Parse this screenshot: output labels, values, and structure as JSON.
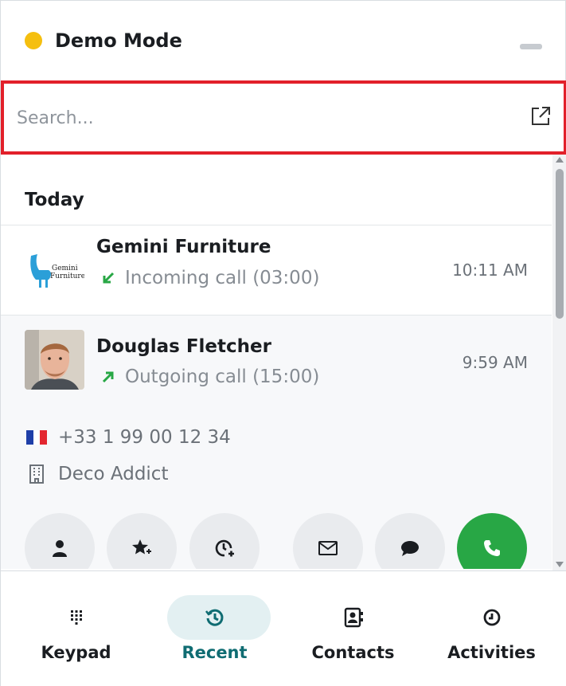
{
  "header": {
    "title": "Demo Mode",
    "status_color": "#f5bf0f"
  },
  "search": {
    "placeholder": "Search..."
  },
  "list": {
    "section": "Today",
    "calls": [
      {
        "name": "Gemini Furniture",
        "type": "Incoming call (03:00)",
        "direction": "incoming",
        "time": "10:11 AM",
        "logo_text": "Gemini Furniture"
      },
      {
        "name": "Douglas Fletcher",
        "type": "Outgoing call (15:00)",
        "direction": "outgoing",
        "time": "9:59 AM",
        "phone": "+33 1 99 00 12 34",
        "company": "Deco Addict",
        "actions": [
          "contact-icon",
          "add-favorite-icon",
          "schedule-activity-icon",
          "email-icon",
          "message-icon",
          "phone-icon"
        ]
      }
    ]
  },
  "nav": [
    {
      "label": "Keypad",
      "icon": "keypad-icon",
      "active": false
    },
    {
      "label": "Recent",
      "icon": "history-icon",
      "active": true
    },
    {
      "label": "Contacts",
      "icon": "contacts-icon",
      "active": false
    },
    {
      "label": "Activities",
      "icon": "clock-icon",
      "active": false
    }
  ],
  "colors": {
    "accent": "#0f6c72",
    "call_green": "#28a745",
    "search_border": "#e2202a",
    "arrow_green": "#28a745"
  }
}
